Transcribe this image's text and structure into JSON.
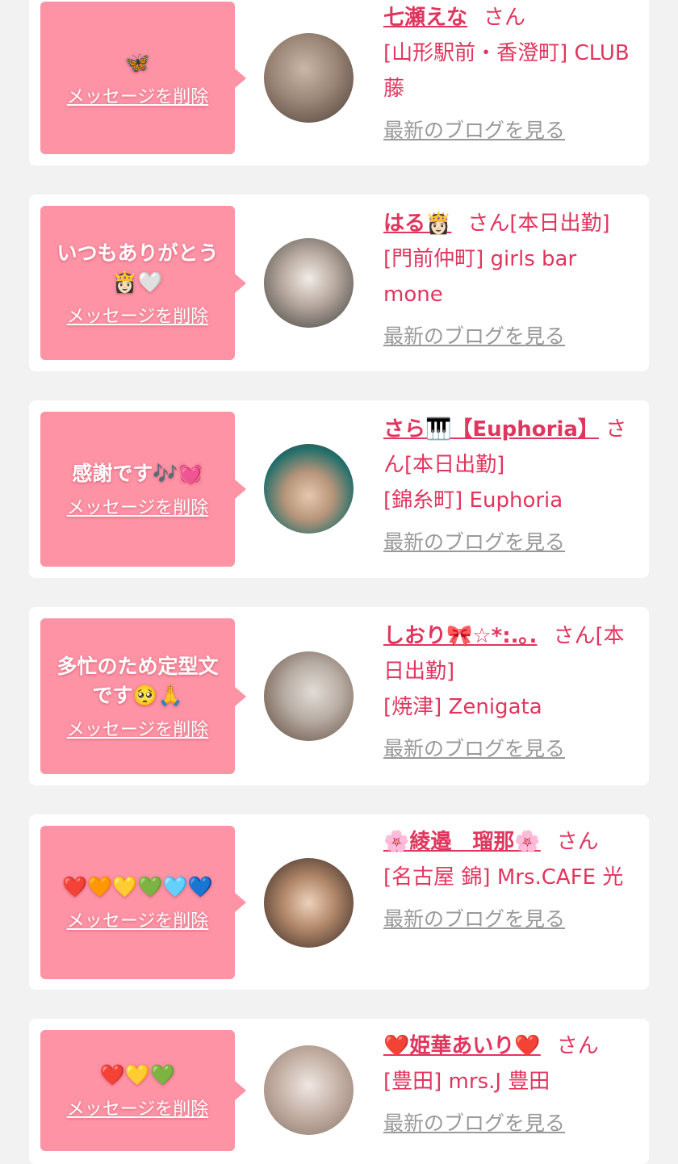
{
  "messages": [
    {
      "text": "🦋",
      "delete_label": "メッセージを削除",
      "name": "七瀬えな",
      "honorific": "さん",
      "status": "",
      "shop": "[山形駅前・香澄町] CLUB 藤",
      "blog_label": "最新のブログを見る",
      "avatar_colors": [
        "#6b5a52",
        "#c9b7a8"
      ]
    },
    {
      "text": "いつもありがとう👸🏻🤍",
      "delete_label": "メッセージを削除",
      "name": "はる👸🏻",
      "honorific": "さん",
      "status": "[本日出勤]",
      "shop": "[門前仲町] girls bar mone",
      "blog_label": "最新のブログを見る",
      "avatar_colors": [
        "#3a3d3a",
        "#e9e3dc"
      ]
    },
    {
      "text": "感謝です🎶💓",
      "delete_label": "メッセージを削除",
      "name": "さら🎹【Euphoria】",
      "honorific": "さん",
      "status": "[本日出勤]",
      "shop": "[錦糸町] Euphoria",
      "blog_label": "最新のブログを見る",
      "avatar_colors": [
        "#1e6e6a",
        "#d8b59a"
      ]
    },
    {
      "text": "多忙のため定型文です🥺🙏",
      "delete_label": "メッセージを削除",
      "name": "しおり🎀☆*:.｡.",
      "honorific": "さん",
      "status": "[本日出勤]",
      "shop": "[焼津] Zenigata",
      "blog_label": "最新のブログを見る",
      "avatar_colors": [
        "#5a4234",
        "#cfc7c0"
      ]
    },
    {
      "text": "❤️🧡💛💚🩵💙",
      "delete_label": "メッセージを削除",
      "name": "🌸綾邉　瑠那🌸",
      "honorific": "さん",
      "status": "",
      "shop": "[名古屋 錦] Mrs.CAFE 光",
      "blog_label": "最新のブログを見る",
      "avatar_colors": [
        "#2e2420",
        "#e4c3a8"
      ]
    },
    {
      "text": "❤️💛💚",
      "delete_label": "メッセージを削除",
      "name": "❤️姫華あいり❤️",
      "honorific": "さん",
      "status": "",
      "shop": "[豊田] mrs.J 豊田",
      "blog_label": "最新のブログを見る",
      "avatar_colors": [
        "#d8d0cc",
        "#8a7268"
      ]
    }
  ],
  "colors": {
    "page_bg": "#f2f2f2",
    "bubble_bg": "#fd93a5",
    "accent": "#e0365e",
    "muted": "#999999"
  }
}
